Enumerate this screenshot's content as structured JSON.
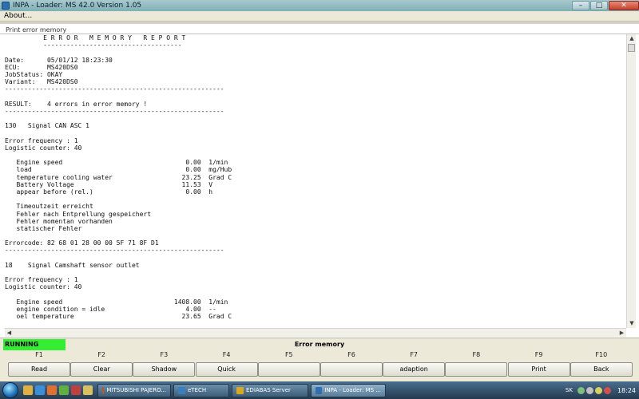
{
  "window": {
    "title": "INPA - Loader:  MS 42.0 Version 1.05",
    "min_icon": "minimize-icon",
    "max_icon": "maximize-icon",
    "close_icon": "close-icon"
  },
  "menu": {
    "items": [
      "About..."
    ]
  },
  "subtitle": "Print error memory",
  "report": {
    "lines": [
      "          E R R O R   M E M O R Y   R E P O R T",
      "          ------------------------------------",
      "",
      "Date:      05/01/12 18:23:30",
      "ECU:       MS420DS0",
      "JobStatus: OKAY",
      "Variant:   MS420DS0",
      "---------------------------------------------------------",
      "",
      "RESULT:    4 errors in error memory !",
      "---------------------------------------------------------",
      "",
      "130   Signal CAN ASC 1",
      "",
      "Error frequency : 1",
      "Logistic counter: 40",
      "",
      "   Engine speed                                0.00  1/min",
      "   load                                        0.00  mg/Hub",
      "   temperature cooling water                  23.25  Grad C",
      "   Battery Voltage                            11.53  V",
      "   appear before (rel.)                        0.00  h",
      "",
      "   Timeoutzeit erreicht",
      "   Fehler nach Entprellung gespeichert",
      "   Fehler momentan vorhanden",
      "   statischer Fehler",
      "",
      "Errorcode: 82 68 01 28 00 00 5F 71 8F D1",
      "---------------------------------------------------------",
      "",
      "18    Signal Camshaft sensor outlet",
      "",
      "Error frequency : 1",
      "Logistic counter: 40",
      "",
      "   Engine speed                             1408.00  1/min",
      "   engine condition = idle                     4.00  --",
      "   oel temperature                            23.65  Grad C"
    ]
  },
  "status": {
    "running": "RUNNING",
    "title": "Error memory"
  },
  "fkeys": [
    {
      "key": "F1",
      "label": "Read"
    },
    {
      "key": "F2",
      "label": "Clear"
    },
    {
      "key": "F3",
      "label": "Shadow"
    },
    {
      "key": "F4",
      "label": "Quick"
    },
    {
      "key": "F5",
      "label": ""
    },
    {
      "key": "F6",
      "label": ""
    },
    {
      "key": "F7",
      "label": "adaption"
    },
    {
      "key": "F8",
      "label": ""
    },
    {
      "key": "F9",
      "label": "Print"
    },
    {
      "key": "F10",
      "label": "Back"
    }
  ],
  "taskbar": {
    "tasks": [
      {
        "label": "MITSUBISHI PAJERO...",
        "icon": "browser-icon",
        "color": "#c2541c"
      },
      {
        "label": "eTECH",
        "icon": "app-icon",
        "color": "#3a7fc0"
      },
      {
        "label": "EDIABAS Server",
        "icon": "server-icon",
        "color": "#d8a820"
      },
      {
        "label": "INPA - Loader:  MS ...",
        "icon": "inpa-icon",
        "color": "#2d6fb0"
      }
    ],
    "lang": "SK",
    "clock": "18:24"
  },
  "colors": {
    "running_green": "#33ee33"
  }
}
